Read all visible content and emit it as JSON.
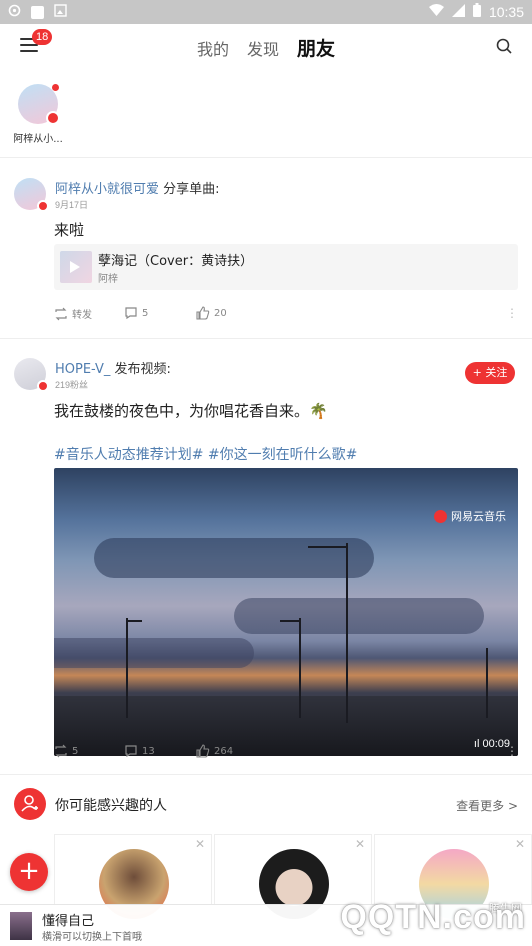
{
  "statusbar": {
    "time": "10:35"
  },
  "topnav": {
    "badge": "18",
    "tabs": [
      "我的",
      "发现",
      "朋友"
    ],
    "active_tab": "朋友"
  },
  "stories": [
    {
      "name": "阿梓从小..."
    }
  ],
  "post1": {
    "user": "阿梓从小就很可爱",
    "action": " 分享单曲:",
    "date": "9月17日",
    "text": "来啦",
    "song_title": "孽海记（Cover：黄诗扶）",
    "song_artist": "阿梓",
    "repost_label": "转发",
    "comments": "5",
    "likes": "20"
  },
  "post2": {
    "user": "HOPE-V_",
    "action": " 发布视频:",
    "fans": "219粉丝",
    "follow_label": "+ 关注",
    "text": "我在鼓楼的夜色中，为你唱花香自来。🌴",
    "hashtags": "#音乐人动态推荐计划# #你这一刻在听什么歌#",
    "video_brand": "网易云音乐",
    "video_duration": "00:09",
    "reposts": "5",
    "comments": "13",
    "likes": "264"
  },
  "recommend": {
    "title": "你可能感兴趣的人",
    "more_label": "查看更多 >"
  },
  "player": {
    "title": "懂得自己",
    "subtitle": "横滑可以切换上下首哦"
  },
  "watermark": {
    "brand": "QQTN.com",
    "small": "腾牛网"
  },
  "colors": {
    "accent": "#e33333",
    "link": "#507daf"
  }
}
